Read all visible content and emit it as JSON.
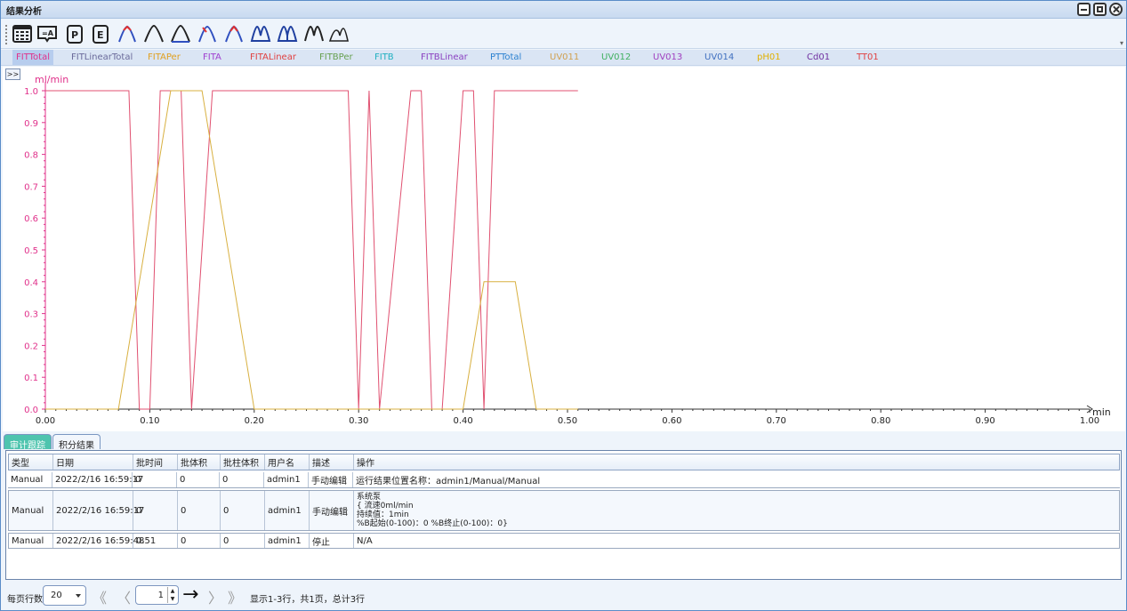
{
  "window": {
    "title": "结果分析"
  },
  "toolbar": {
    "tools": [
      {
        "name": "table-icon"
      },
      {
        "name": "text-annotation-icon"
      },
      {
        "name": "p-icon"
      },
      {
        "name": "e-icon"
      },
      {
        "name": "peak-marker-icon"
      },
      {
        "name": "peak-icon"
      },
      {
        "name": "peak-baseline-icon"
      },
      {
        "name": "peak-start-icon"
      },
      {
        "name": "peak-end-icon"
      },
      {
        "name": "multi-peak-icon"
      },
      {
        "name": "multi-peak-split-icon"
      },
      {
        "name": "multi-peak-drop-icon"
      },
      {
        "name": "peak-shoulder-icon"
      }
    ]
  },
  "legend": {
    "items": [
      {
        "label": "FITTotal",
        "color": "#e0308a"
      },
      {
        "label": "FITLinearTotal",
        "color": "#6a6a9a"
      },
      {
        "label": "FITAPer",
        "color": "#e0a020"
      },
      {
        "label": "FITA",
        "color": "#a040d0"
      },
      {
        "label": "FITALinear",
        "color": "#e04040"
      },
      {
        "label": "FITBPer",
        "color": "#66a050"
      },
      {
        "label": "FITB",
        "color": "#20b0c0"
      },
      {
        "label": "FITBLinear",
        "color": "#8a40c0"
      },
      {
        "label": "PTTotal",
        "color": "#2a80d0"
      },
      {
        "label": "UV011",
        "color": "#d0a050"
      },
      {
        "label": "UV012",
        "color": "#40b060"
      },
      {
        "label": "UV013",
        "color": "#a040c0"
      },
      {
        "label": "UV014",
        "color": "#4070c0"
      },
      {
        "label": "pH01",
        "color": "#e0b000"
      },
      {
        "label": "Cd01",
        "color": "#7030a0"
      },
      {
        "label": "TT01",
        "color": "#e04040"
      }
    ]
  },
  "chart": {
    "expander": ">>",
    "ylabel": "ml/min",
    "xlabel": "min"
  },
  "chart_data": {
    "type": "line",
    "ylabel": "ml/min",
    "xlabel": "min",
    "xlim": [
      0.0,
      1.0
    ],
    "ylim": [
      0.0,
      1.0
    ],
    "xticks": [
      "0.00",
      "0.10",
      "0.20",
      "0.30",
      "0.40",
      "0.50",
      "0.60",
      "0.70",
      "0.80",
      "0.90",
      "1.00"
    ],
    "yticks": [
      "0.0",
      "0.1",
      "0.2",
      "0.3",
      "0.4",
      "0.5",
      "0.6",
      "0.7",
      "0.8",
      "0.9",
      "1.0"
    ],
    "series": [
      {
        "color": "#e05070",
        "x": [
          0.0,
          0.08,
          0.09,
          0.1,
          0.11,
          0.13,
          0.14,
          0.16,
          0.17,
          0.18,
          0.29,
          0.3,
          0.31,
          0.32,
          0.35,
          0.36,
          0.37,
          0.38,
          0.4,
          0.41,
          0.42,
          0.43,
          0.51
        ],
        "y": [
          1.0,
          1.0,
          0.0,
          0.0,
          1.0,
          1.0,
          0.0,
          1.0,
          1.0,
          1.0,
          1.0,
          0.0,
          1.0,
          0.0,
          1.0,
          1.0,
          0.0,
          0.0,
          1.0,
          1.0,
          0.0,
          1.0,
          1.0
        ]
      },
      {
        "color": "#d8b040",
        "x": [
          0.0,
          0.07,
          0.12,
          0.15,
          0.2,
          0.4,
          0.42,
          0.45,
          0.47,
          0.51
        ],
        "y": [
          0.0,
          0.0,
          1.0,
          1.0,
          0.0,
          0.0,
          0.4,
          0.4,
          0.0,
          0.0
        ]
      }
    ]
  },
  "tabs": [
    {
      "label": "审计跟踪",
      "active": true
    },
    {
      "label": "积分结果",
      "active": false
    }
  ],
  "grid": {
    "columns": [
      "类型",
      "日期",
      "批时间",
      "批体积",
      "批柱体积",
      "用户名",
      "描述",
      "操作"
    ],
    "rows": [
      {
        "type": "Manual",
        "date": "2022/2/16 16:59:17",
        "time": "0",
        "vol": "0",
        "cvol": "0",
        "user": "admin1",
        "desc": "手动编辑",
        "op": [
          "运行结果位置名称：admin1/Manual/Manual"
        ]
      },
      {
        "type": "Manual",
        "date": "2022/2/16 16:59:17",
        "time": "0",
        "vol": "0",
        "cvol": "0",
        "user": "admin1",
        "desc": "手动编辑",
        "op": [
          "系统泵",
          "{ 流速0ml/min",
          "持续值：1min",
          "%B起始(0-100)：0 %B终止(0-100)：0}"
        ]
      },
      {
        "type": "Manual",
        "date": "2022/2/16 16:59:48",
        "time": "0.51",
        "vol": "0",
        "cvol": "0",
        "user": "admin1",
        "desc": "停止",
        "op": [
          "N/A"
        ]
      }
    ]
  },
  "pager": {
    "rows_label": "每页行数",
    "page_size": "20",
    "page_number": "1",
    "info": "显示1-3行，共1页，总计3行"
  }
}
